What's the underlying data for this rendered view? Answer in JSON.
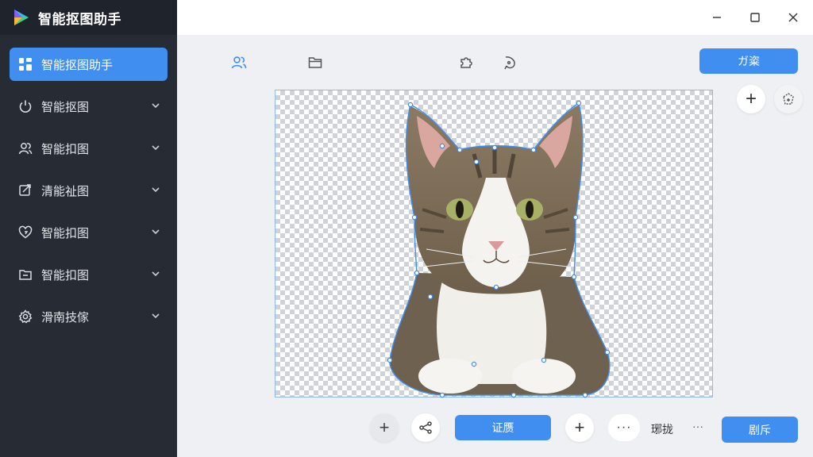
{
  "app": {
    "title": "智能抠图助手",
    "logo_icon": "app-logo-icon"
  },
  "sidebar": {
    "items": [
      {
        "label": "智能抠图助手",
        "icon": "grid-icon",
        "active": true
      },
      {
        "label": "智能抠图",
        "icon": "power-icon"
      },
      {
        "label": "智能扣图",
        "icon": "people-icon"
      },
      {
        "label": "清能祉图",
        "icon": "crop-icon"
      },
      {
        "label": "智能扣图",
        "icon": "heart-icon"
      },
      {
        "label": "智能扣图",
        "icon": "folder-icon"
      },
      {
        "label": "滑南技傢",
        "icon": "gear-icon"
      }
    ]
  },
  "toolbar": {
    "primary_label": "ガ粢",
    "tools": [
      "users-icon",
      "folder-icon",
      "puzzle-icon",
      "lasso-icon"
    ]
  },
  "side_tools": {
    "add": "+",
    "shape": "polygon-edit-icon"
  },
  "bottom": {
    "add1": "+",
    "share": "share-icon",
    "confirm_label": "证赝",
    "add2": "+",
    "more1": "···",
    "text_label": "琊拢",
    "more2": "···",
    "finish_label": "剧斥"
  },
  "colors": {
    "accent": "#3f8ef0",
    "sidebar": "#262b34",
    "sidebar_header": "#1f232b"
  }
}
